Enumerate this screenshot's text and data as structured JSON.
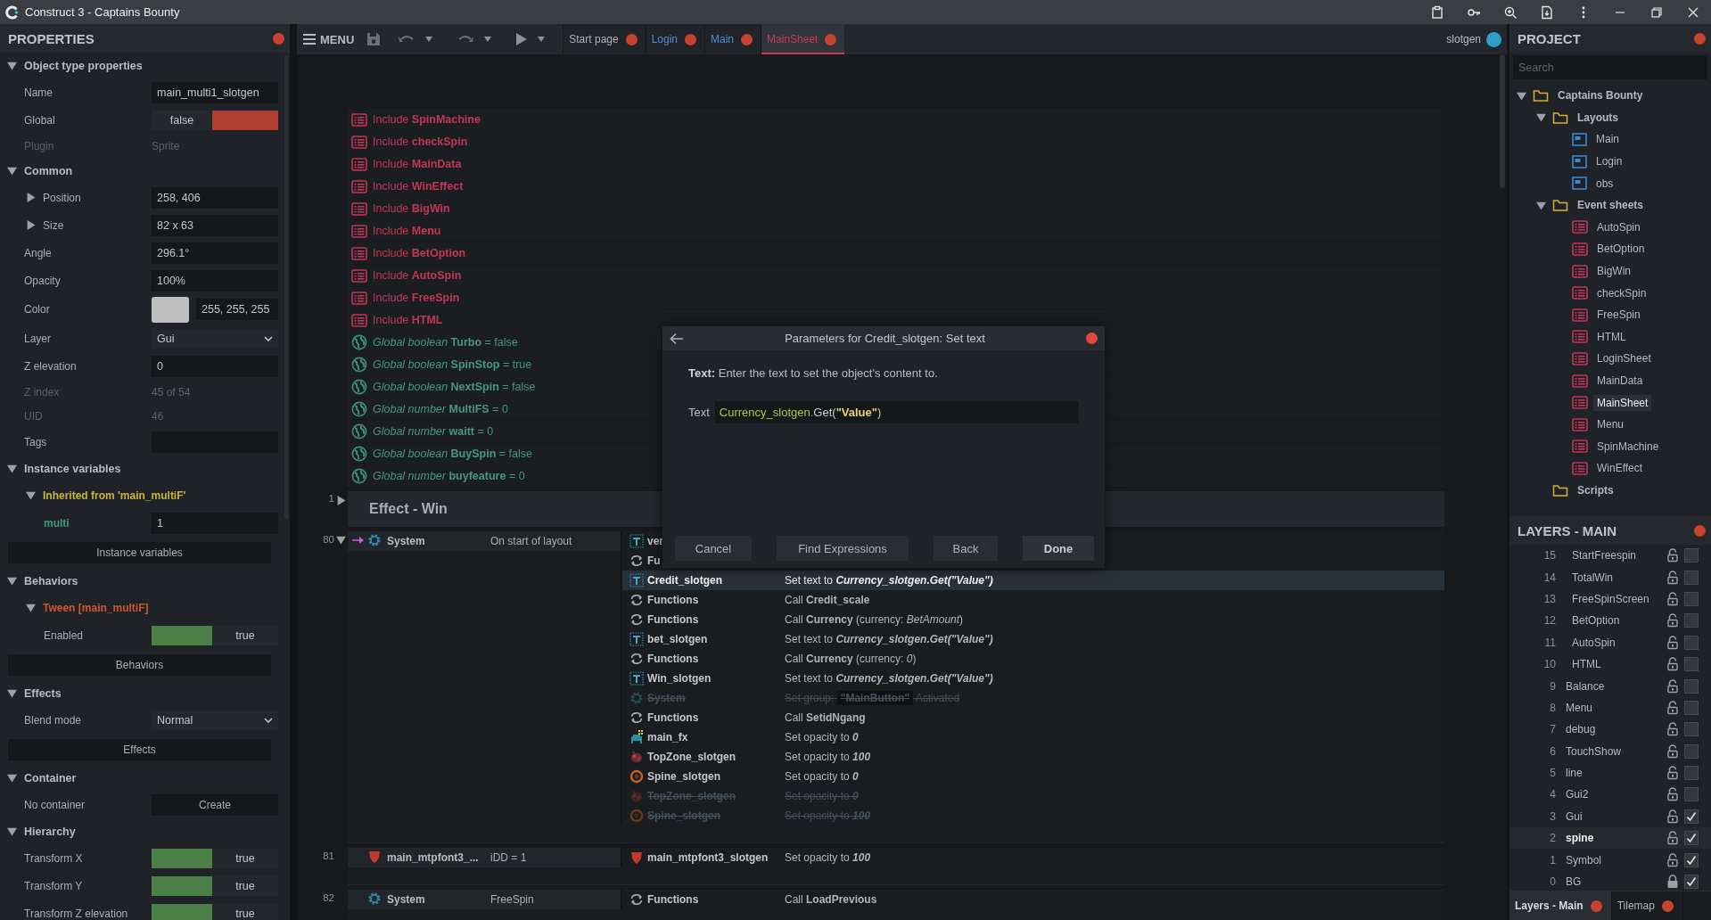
{
  "window": {
    "title": "Construct 3 - Captains Bounty"
  },
  "toolbar": {
    "menu": "MENU",
    "user": "slotgen",
    "tabs": [
      {
        "label": "Start page",
        "kind": "start",
        "selected": false
      },
      {
        "label": "Login",
        "kind": "layout",
        "selected": false
      },
      {
        "label": "Main",
        "kind": "layout",
        "selected": false
      },
      {
        "label": "MainSheet",
        "kind": "event_sheet",
        "selected": true
      }
    ]
  },
  "properties": {
    "title": "PROPERTIES",
    "sections": [
      {
        "title": "Object type properties",
        "expanded": true,
        "rows": [
          {
            "kind": "field",
            "label": "Name",
            "value": "main_multi1_slotgen"
          },
          {
            "kind": "toggle",
            "label": "Global",
            "value": "false",
            "on": false
          },
          {
            "kind": "readonly",
            "label": "Plugin",
            "value": "Sprite"
          }
        ]
      },
      {
        "title": "Common",
        "expanded": true,
        "rows": [
          {
            "kind": "expandable",
            "label": "Position",
            "value": "258, 406",
            "expanded": false
          },
          {
            "kind": "expandable",
            "label": "Size",
            "value": "82 x 63",
            "expanded": false
          },
          {
            "kind": "field",
            "label": "Angle",
            "value": "296.1°"
          },
          {
            "kind": "field",
            "label": "Opacity",
            "value": "100%"
          },
          {
            "kind": "color",
            "label": "Color",
            "value": "255, 255, 255"
          },
          {
            "kind": "dropdown",
            "label": "Layer",
            "value": "Gui"
          },
          {
            "kind": "field",
            "label": "Z elevation",
            "value": "0"
          },
          {
            "kind": "readonly",
            "label": "Z index",
            "value": "45 of 54"
          },
          {
            "kind": "readonly",
            "label": "UID",
            "value": "46"
          },
          {
            "kind": "field",
            "label": "Tags"
          }
        ]
      },
      {
        "title": "Instance variables",
        "expanded": true,
        "rows": [
          {
            "kind": "subgroup",
            "label": "Inherited from 'main_multiF'",
            "expanded": true,
            "color": "#c9b43a",
            "rows": [
              {
                "kind": "variable",
                "label": "multi",
                "value": "1"
              }
            ]
          },
          {
            "kind": "button",
            "label": "Instance variables"
          }
        ]
      },
      {
        "title": "Behaviors",
        "expanded": true,
        "rows": [
          {
            "kind": "subgroup",
            "label": "Tween [main_multiF]",
            "expanded": true,
            "color": "#cf5530",
            "rows": [
              {
                "kind": "toggle",
                "label": "Enabled",
                "value": "true",
                "on": true
              }
            ]
          },
          {
            "kind": "button",
            "label": "Behaviors"
          }
        ]
      },
      {
        "title": "Effects",
        "expanded": true,
        "rows": [
          {
            "kind": "dropdown",
            "label": "Blend mode",
            "value": "Normal"
          },
          {
            "kind": "button",
            "label": "Effects"
          }
        ]
      },
      {
        "title": "Container",
        "expanded": true,
        "rows": [
          {
            "kind": "action",
            "label": "No container",
            "value": "Create"
          }
        ]
      },
      {
        "title": "Hierarchy",
        "expanded": true,
        "rows": [
          {
            "kind": "toggle",
            "label": "Transform X",
            "value": "true",
            "on": true
          },
          {
            "kind": "toggle",
            "label": "Transform Y",
            "value": "true",
            "on": true
          },
          {
            "kind": "toggle",
            "label": "Transform Z elevation",
            "value": "true",
            "on": true
          }
        ]
      }
    ]
  },
  "event_sheet": {
    "rows": [
      {
        "kind": "include",
        "keyword": "Include",
        "name": "SpinMachine"
      },
      {
        "kind": "include",
        "keyword": "Include",
        "name": "checkSpin"
      },
      {
        "kind": "include",
        "keyword": "Include",
        "name": "MainData"
      },
      {
        "kind": "include",
        "keyword": "Include",
        "name": "WinEffect"
      },
      {
        "kind": "include",
        "keyword": "Include",
        "name": "BigWin"
      },
      {
        "kind": "include",
        "keyword": "Include",
        "name": "Menu"
      },
      {
        "kind": "include",
        "keyword": "Include",
        "name": "BetOption"
      },
      {
        "kind": "include",
        "keyword": "Include",
        "name": "AutoSpin"
      },
      {
        "kind": "include",
        "keyword": "Include",
        "name": "FreeSpin"
      },
      {
        "kind": "include",
        "keyword": "Include",
        "name": "HTML"
      },
      {
        "kind": "global",
        "declaration": "Global boolean",
        "name": "Turbo",
        "value": "= false"
      },
      {
        "kind": "global",
        "declaration": "Global boolean",
        "name": "SpinStop",
        "value": "= true"
      },
      {
        "kind": "global",
        "declaration": "Global boolean",
        "name": "NextSpin",
        "value": "= false"
      },
      {
        "kind": "global",
        "declaration": "Global number",
        "name": "MultiFS",
        "value": "= 0"
      },
      {
        "kind": "global",
        "declaration": "Global number",
        "name": "waitt",
        "value": "= 0"
      },
      {
        "kind": "global",
        "declaration": "Global boolean",
        "name": "BuySpin",
        "value": "= false"
      },
      {
        "kind": "global",
        "declaration": "Global number",
        "name": "buyfeature",
        "value": "= 0"
      },
      {
        "kind": "group",
        "line": "1",
        "title": "Effect - Win",
        "expanded": false
      },
      {
        "kind": "event",
        "line": "80",
        "expanded": true,
        "trigger": true,
        "conditions": [
          {
            "kind": "system",
            "object": "System",
            "text": "On start of layout"
          }
        ],
        "actions": [
          {
            "kind": "text",
            "object": "ver",
            "selected": false,
            "disabled": false
          },
          {
            "kind": "functions",
            "object": "Fu",
            "selected": false,
            "disabled": false
          },
          {
            "kind": "text",
            "object": "Credit_slotgen",
            "text": "Set text to",
            "value": "Currency_slotgen.Get(\"Value\")",
            "selected": true,
            "disabled": false
          },
          {
            "kind": "functions",
            "object": "Functions",
            "text": "Call **Credit_scale**",
            "selected": false,
            "disabled": false
          },
          {
            "kind": "functions",
            "object": "Functions",
            "text": "Call **Currency** (currency: *BetAmount*)",
            "selected": false,
            "disabled": false
          },
          {
            "kind": "text",
            "object": "bet_slotgen",
            "text": "Set text to",
            "value": "Currency_slotgen.Get(\"Value\")",
            "selected": false,
            "disabled": false
          },
          {
            "kind": "functions",
            "object": "Functions",
            "text": "Call **Currency** (currency: *0*)",
            "selected": false,
            "disabled": false
          },
          {
            "kind": "text",
            "object": "Win_slotgen",
            "text": "Set text to",
            "value": "Currency_slotgen.Get(\"Value\")",
            "selected": false,
            "disabled": false
          },
          {
            "kind": "system",
            "object": "System",
            "text": "Set group:",
            "chip": "\"MainButton\"",
            "suffix": "Activated",
            "selected": false,
            "disabled": true
          },
          {
            "kind": "functions",
            "object": "Functions",
            "text": "Call **SetidNgang**",
            "selected": false,
            "disabled": false
          },
          {
            "kind": "invader",
            "object": "main_fx",
            "text": "Set opacity to",
            "value": "0",
            "selected": false,
            "disabled": false
          },
          {
            "kind": "creature",
            "object": "TopZone_slotgen",
            "text": "Set opacity to",
            "value": "100",
            "selected": false,
            "disabled": false
          },
          {
            "kind": "spine",
            "object": "Spine_slotgen",
            "text": "Set opacity to",
            "value": "0",
            "selected": false,
            "disabled": false
          },
          {
            "kind": "creature",
            "object": "TopZone_slotgen",
            "text": "Set opacity to",
            "value": "0",
            "selected": false,
            "disabled": true
          },
          {
            "kind": "spine",
            "object": "Spine_slotgen",
            "text": "Set opacity to",
            "value": "100",
            "selected": false,
            "disabled": true
          }
        ]
      },
      {
        "kind": "event",
        "line": "81",
        "trigger": false,
        "conditions": [
          {
            "kind": "shield",
            "object": "main_mtpfont3_...",
            "text": "iDD = 1"
          }
        ],
        "actions": [
          {
            "kind": "shield",
            "object": "main_mtpfont3_slotgen",
            "text": "Set opacity to",
            "value": "100",
            "selected": false,
            "disabled": false
          }
        ]
      },
      {
        "kind": "event",
        "line": "82",
        "trigger": false,
        "conditions": [
          {
            "kind": "system",
            "object": "System",
            "text": "FreeSpin"
          }
        ],
        "actions": [
          {
            "kind": "functions",
            "object": "Functions",
            "text": "Call **LoadPrevious**",
            "selected": false,
            "disabled": false
          }
        ]
      }
    ]
  },
  "dialog": {
    "title": "Parameters for Credit_slotgen: Set text",
    "description": "**Text:** Enter the text to set the object's content to.",
    "parameter": {
      "label": "Text",
      "tokens": [
        {
          "kind": "object",
          "text": "Currency_slotgen"
        },
        {
          "kind": "dot",
          "text": "."
        },
        {
          "kind": "method",
          "text": "Get("
        },
        {
          "kind": "string",
          "text": "\"Value\""
        },
        {
          "kind": "paren",
          "text": ")"
        }
      ]
    },
    "buttons": [
      {
        "label": "Cancel",
        "primary": false
      },
      {
        "label": "Find Expressions",
        "primary": false
      },
      {
        "label": "Back",
        "primary": false
      },
      {
        "label": "Done",
        "primary": true
      }
    ]
  },
  "project": {
    "title": "PROJECT",
    "search": {
      "placeholder": "Search"
    },
    "tree": [
      {
        "kind": "folder",
        "label": "Captains Bounty",
        "expanded": true,
        "selected": false,
        "children": [
          {
            "kind": "folder",
            "label": "Layouts",
            "expanded": true,
            "selected": false,
            "children": [
              {
                "kind": "layout",
                "label": "Main",
                "selected": false
              },
              {
                "kind": "layout",
                "label": "Login",
                "selected": false
              },
              {
                "kind": "layout",
                "label": "obs",
                "selected": false
              }
            ]
          },
          {
            "kind": "folder",
            "label": "Event sheets",
            "expanded": true,
            "selected": false,
            "children": [
              {
                "kind": "event_sheet",
                "label": "AutoSpin",
                "selected": false
              },
              {
                "kind": "event_sheet",
                "label": "BetOption",
                "selected": false
              },
              {
                "kind": "event_sheet",
                "label": "BigWin",
                "selected": false
              },
              {
                "kind": "event_sheet",
                "label": "checkSpin",
                "selected": false
              },
              {
                "kind": "event_sheet",
                "label": "FreeSpin",
                "selected": false
              },
              {
                "kind": "event_sheet",
                "label": "HTML",
                "selected": false
              },
              {
                "kind": "event_sheet",
                "label": "LoginSheet",
                "selected": false
              },
              {
                "kind": "event_sheet",
                "label": "MainData",
                "selected": false
              },
              {
                "kind": "event_sheet",
                "label": "MainSheet",
                "selected": true
              },
              {
                "kind": "event_sheet",
                "label": "Menu",
                "selected": false
              },
              {
                "kind": "event_sheet",
                "label": "SpinMachine",
                "selected": false
              },
              {
                "kind": "event_sheet",
                "label": "WinEffect",
                "selected": false
              }
            ]
          },
          {
            "kind": "folder",
            "label": "Scripts",
            "selected": false
          }
        ]
      }
    ]
  },
  "layers": {
    "title": "LAYERS - MAIN",
    "items": [
      {
        "number": "15",
        "name": "StartFreespin",
        "kind": "sublayer",
        "locked": false,
        "visible": false,
        "selected": false
      },
      {
        "number": "14",
        "name": "TotalWin",
        "kind": "sublayer",
        "locked": false,
        "visible": false,
        "selected": false
      },
      {
        "number": "13",
        "name": "FreeSpinScreen",
        "kind": "sublayer",
        "locked": false,
        "visible": false,
        "selected": false
      },
      {
        "number": "12",
        "name": "BetOption",
        "kind": "sublayer",
        "locked": false,
        "visible": false,
        "selected": false
      },
      {
        "number": "11",
        "name": "AutoSpin",
        "kind": "sublayer",
        "locked": false,
        "visible": false,
        "selected": false
      },
      {
        "number": "10",
        "name": "HTML",
        "kind": "sublayer",
        "locked": false,
        "visible": false,
        "selected": false
      },
      {
        "number": "9",
        "name": "Balance",
        "kind": "layer",
        "locked": false,
        "visible": false,
        "selected": false
      },
      {
        "number": "8",
        "name": "Menu",
        "kind": "layer",
        "locked": false,
        "visible": false,
        "selected": false
      },
      {
        "number": "7",
        "name": "debug",
        "kind": "layer",
        "locked": false,
        "visible": false,
        "selected": false
      },
      {
        "number": "6",
        "name": "TouchShow",
        "kind": "layer",
        "locked": false,
        "visible": false,
        "selected": false
      },
      {
        "number": "5",
        "name": "line",
        "kind": "layer",
        "locked": false,
        "visible": false,
        "selected": false
      },
      {
        "number": "4",
        "name": "Gui2",
        "kind": "layer",
        "locked": false,
        "visible": false,
        "selected": false
      },
      {
        "number": "3",
        "name": "Gui",
        "kind": "layer",
        "locked": false,
        "visible": true,
        "selected": false
      },
      {
        "number": "2",
        "name": "spine",
        "kind": "layer",
        "locked": false,
        "visible": true,
        "selected": true
      },
      {
        "number": "1",
        "name": "Symbol",
        "kind": "layer",
        "locked": false,
        "visible": true,
        "selected": false
      },
      {
        "number": "0",
        "name": "BG",
        "kind": "layer",
        "locked": true,
        "visible": true,
        "selected": false
      }
    ]
  },
  "bottom_tabs": [
    {
      "label": "Layers - Main",
      "selected": true
    },
    {
      "label": "Tilemap",
      "selected": false
    }
  ]
}
